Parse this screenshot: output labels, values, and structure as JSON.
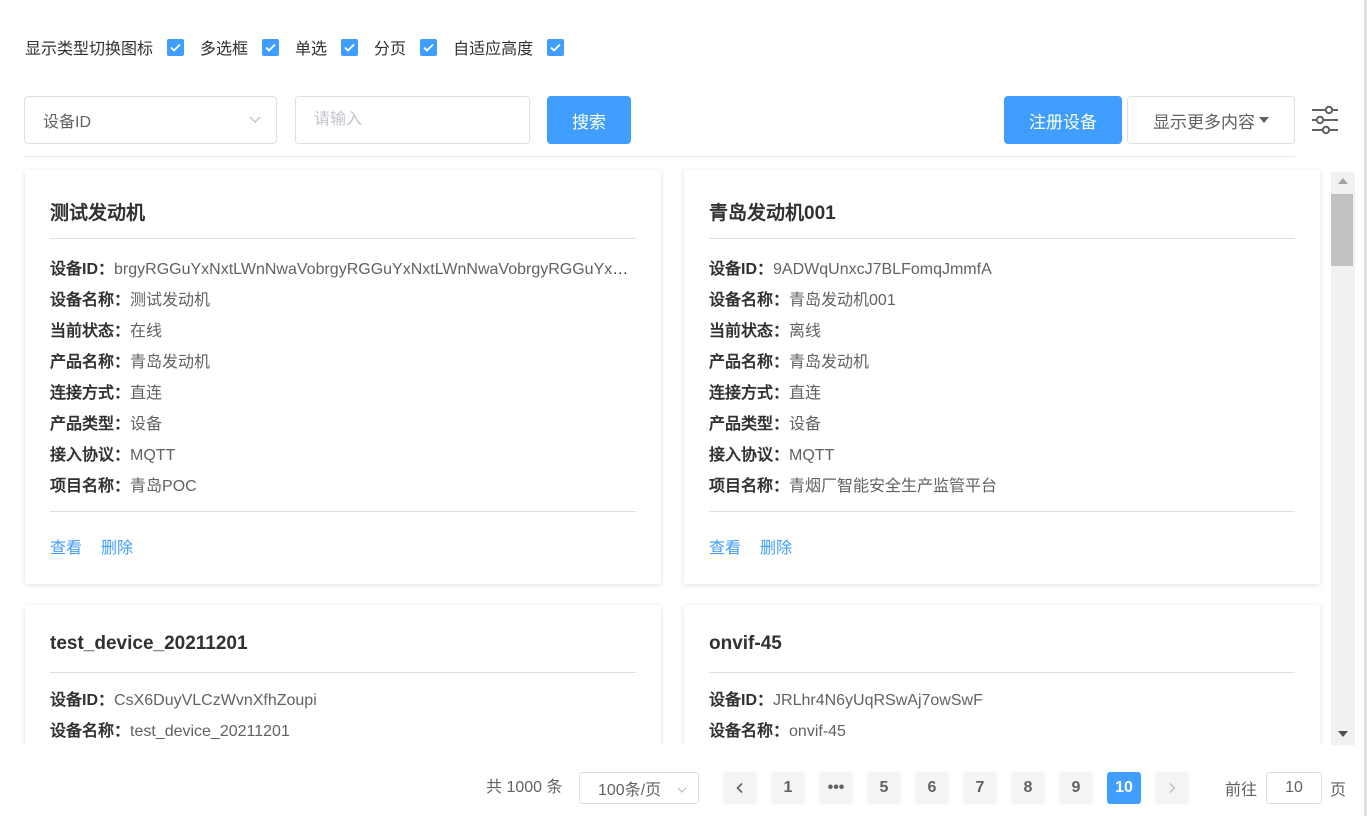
{
  "options": [
    {
      "label": "显示类型切换图标",
      "checked": true
    },
    {
      "label": "多选框",
      "checked": true
    },
    {
      "label": "单选",
      "checked": true
    },
    {
      "label": "分页",
      "checked": true
    },
    {
      "label": "自适应高度",
      "checked": true
    }
  ],
  "search": {
    "field_selected": "设备ID",
    "placeholder": "请输入",
    "search_label": "搜索"
  },
  "toolbar": {
    "register_label": "注册设备",
    "more_label": "显示更多内容"
  },
  "colors": {
    "primary": "#409eff",
    "border": "#dcdfe6"
  },
  "cards": [
    {
      "title": "测试发动机",
      "fields": [
        {
          "key": "设备ID：",
          "value": "brgyRGGuYxNxtLWnNwaVobrgyRGGuYxNxtLWnNwaVobrgyRGGuYxNxtLWnNwaVo"
        },
        {
          "key": "设备名称：",
          "value": "测试发动机"
        },
        {
          "key": "当前状态：",
          "value": "在线"
        },
        {
          "key": "产品名称：",
          "value": "青岛发动机"
        },
        {
          "key": "连接方式：",
          "value": "直连"
        },
        {
          "key": "产品类型：",
          "value": "设备"
        },
        {
          "key": "接入协议：",
          "value": "MQTT"
        },
        {
          "key": "项目名称：",
          "value": "青岛POC"
        }
      ],
      "view_label": "查看",
      "delete_label": "删除"
    },
    {
      "title": "青岛发动机001",
      "fields": [
        {
          "key": "设备ID：",
          "value": "9ADWqUnxcJ7BLFomqJmmfA"
        },
        {
          "key": "设备名称：",
          "value": "青岛发动机001"
        },
        {
          "key": "当前状态：",
          "value": "离线"
        },
        {
          "key": "产品名称：",
          "value": "青岛发动机"
        },
        {
          "key": "连接方式：",
          "value": "直连"
        },
        {
          "key": "产品类型：",
          "value": "设备"
        },
        {
          "key": "接入协议：",
          "value": "MQTT"
        },
        {
          "key": "项目名称：",
          "value": "青烟厂智能安全生产监管平台"
        }
      ],
      "view_label": "查看",
      "delete_label": "删除"
    },
    {
      "title": "test_device_20211201",
      "fields": [
        {
          "key": "设备ID：",
          "value": "CsX6DuyVLCzWvnXfhZoupi"
        },
        {
          "key": "设备名称：",
          "value": "test_device_20211201"
        }
      ]
    },
    {
      "title": "onvif-45",
      "fields": [
        {
          "key": "设备ID：",
          "value": "JRLhr4N6yUqRSwAj7owSwF"
        },
        {
          "key": "设备名称：",
          "value": "onvif-45"
        }
      ]
    }
  ],
  "pagination": {
    "total_text": "共 1000 条",
    "page_size": "100条/页",
    "pages": [
      "1",
      "•••",
      "5",
      "6",
      "7",
      "8",
      "9",
      "10"
    ],
    "current": "10",
    "goto_label": "前往",
    "goto_value": "10",
    "page_suffix": "页"
  }
}
